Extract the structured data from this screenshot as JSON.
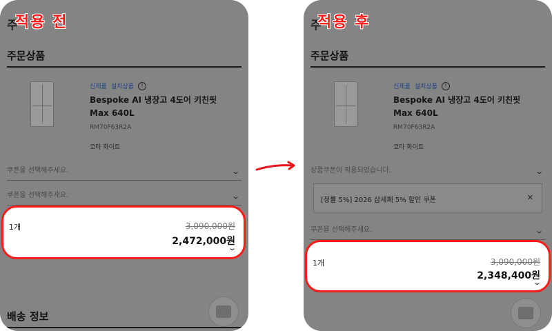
{
  "before": {
    "tag": "적용 전",
    "header_fragment": "주",
    "section_title": "주문상품",
    "product": {
      "badge_new": "신제품",
      "badge_install": "설치상품",
      "name": "Bespoke AI 냉장고 4도어 키친핏 Max 640L",
      "model": "RM70F63R2A",
      "color": "코타 화이트"
    },
    "coupon_select_1": "쿠폰을 선택해주세요.",
    "coupon_select_2": "쿠폰을 선택해주세요.",
    "price": {
      "qty": "1개",
      "original": "3,090,000원",
      "final": "2,472,000원"
    },
    "bottom_section": "배송 정보"
  },
  "after": {
    "tag": "적용 후",
    "header_fragment": "주",
    "section_title": "주문상품",
    "product": {
      "badge_new": "신제품",
      "badge_install": "설치상품",
      "name": "Bespoke AI 냉장고 4도어 키친핏 Max 640L",
      "model": "RM70F63R2A",
      "color": "코타 화이트"
    },
    "coupon_applied": "상품쿠폰이 적용되었습니다.",
    "coupon_item": "[정률 5%] 2026 삼세페 5% 할인 쿠폰",
    "coupon_select": "쿠폰을 선택해주세요.",
    "price": {
      "qty": "1개",
      "original": "3,090,000원",
      "final": "2,348,400원"
    }
  },
  "icons": {
    "info": "info-icon",
    "chevron": "chevron-down-icon",
    "close": "close-icon",
    "arrow": "arrow-right-icon"
  },
  "colors": {
    "highlight": "#ff1a1a",
    "overlay": "#848484",
    "badge": "#1b3f8a"
  }
}
